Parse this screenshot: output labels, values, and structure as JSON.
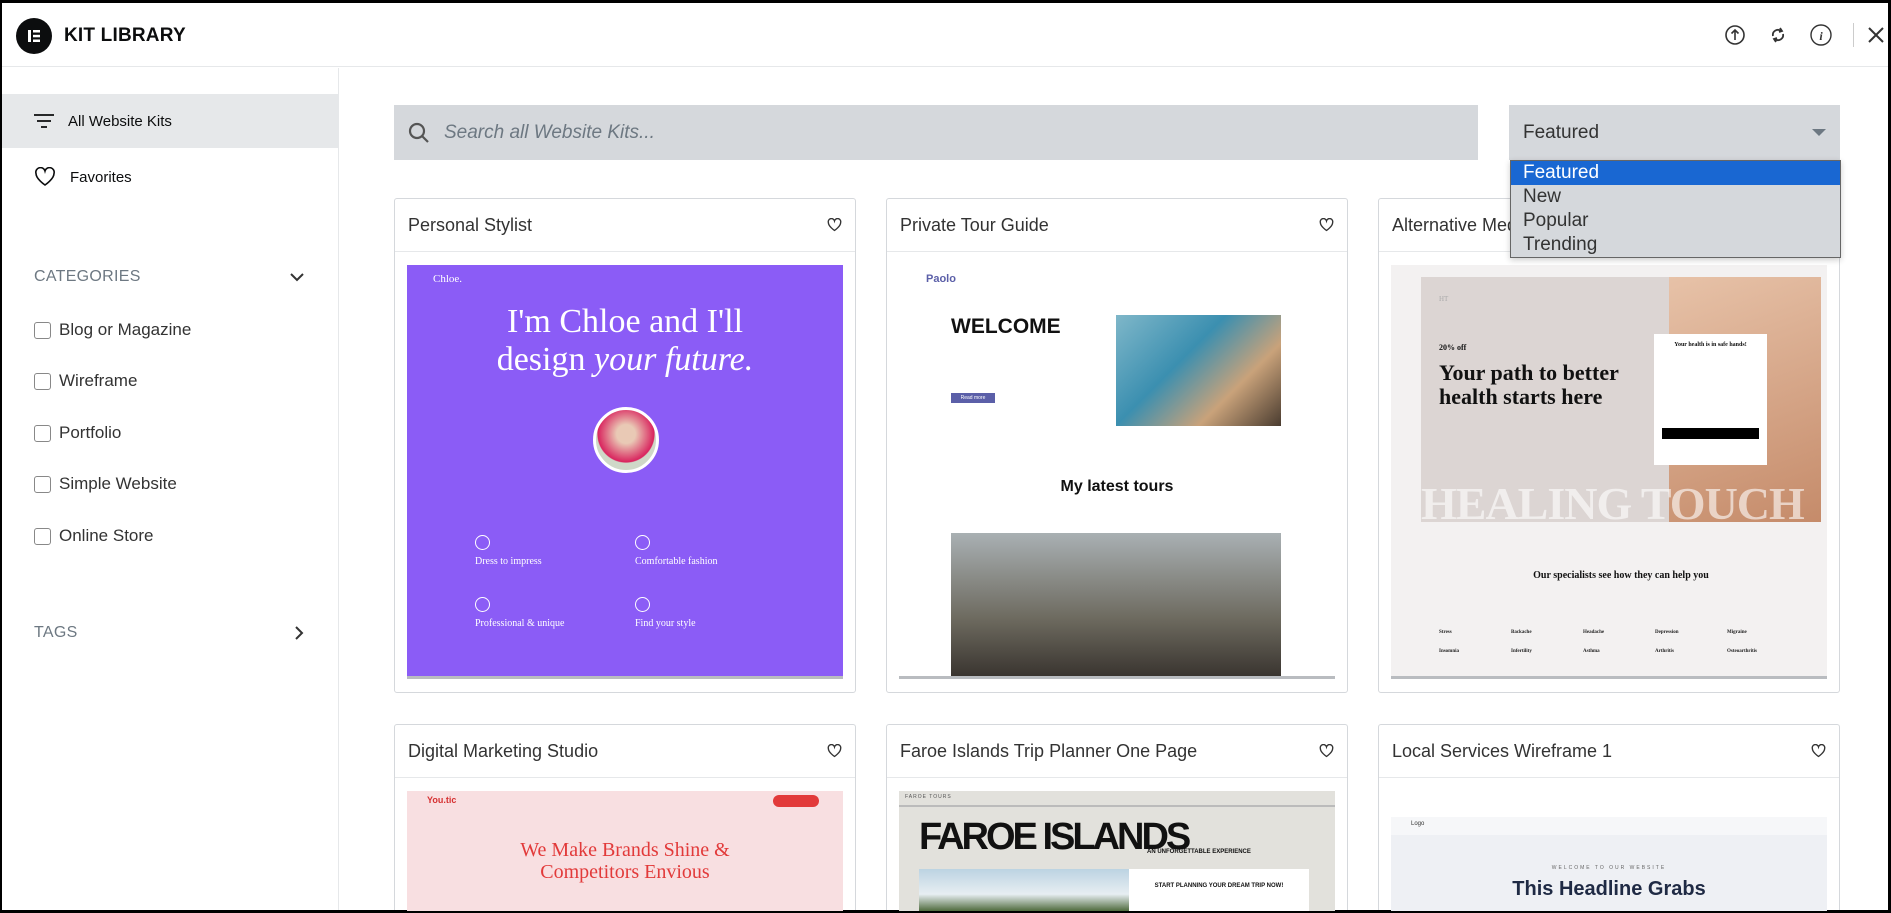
{
  "header": {
    "title": "KIT LIBRARY",
    "icons": [
      "elementor-logo-icon",
      "upload-icon",
      "sync-icon",
      "info-icon",
      "close-icon"
    ]
  },
  "sidebar": {
    "items": [
      {
        "label": "All Website Kits",
        "icon": "filter-lines-icon",
        "active": true
      },
      {
        "label": "Favorites",
        "icon": "heart-icon"
      }
    ],
    "categories_label": "CATEGORIES",
    "categories": [
      "Blog or Magazine",
      "Wireframe",
      "Portfolio",
      "Simple Website",
      "Online Store"
    ],
    "tags_label": "TAGS"
  },
  "search": {
    "placeholder": "Search all Website Kits...",
    "value": ""
  },
  "sort": {
    "selected": "Featured",
    "options": [
      "Featured",
      "New",
      "Popular",
      "Trending"
    ],
    "highlight_color": "#1967d2"
  },
  "kits": [
    {
      "title": "Personal Stylist",
      "preview": {
        "brand": "Chloe.",
        "headline1": "I'm Chloe and I'll",
        "headline2": "design ",
        "headline_em": "your future.",
        "features": [
          "Dress to impress",
          "Comfortable fashion",
          "Professional & unique",
          "Find your style"
        ],
        "bg": "#8b5cf6"
      }
    },
    {
      "title": "Private Tour Guide",
      "preview": {
        "brand": "Paolo",
        "headline": "WELCOME",
        "section": "My latest tours",
        "button": "Read more"
      }
    },
    {
      "title": "Alternative Med",
      "preview": {
        "brand": "HT",
        "promo": "20% off",
        "headline": "Your path to better health starts here",
        "form_title": "Your health is in safe hands!",
        "bg_text": "HEALING TOUCH",
        "section": "Our specialists see how they can help you",
        "conditions": [
          "Stress",
          "Backache",
          "Headache",
          "Depression",
          "Migraine",
          "Insomnia",
          "Infertility",
          "Asthma",
          "Arthritis",
          "Osteoarthritis"
        ]
      }
    },
    {
      "title": "Digital Marketing Studio",
      "preview": {
        "brand": "You.tic",
        "headline": "We Make Brands Shine & Competitors Envious"
      }
    },
    {
      "title": "Faroe Islands Trip Planner One Page",
      "preview": {
        "brand": "FAROE TOURS",
        "headline": "FAROE ISLANDS",
        "sub": "AN UNFORGETTABLE EXPERIENCE",
        "cta": "START PLANNING YOUR DREAM TRIP NOW!"
      }
    },
    {
      "title": "Local Services Wireframe 1",
      "preview": {
        "brand": "Logo",
        "eyebrow": "WELCOME TO OUR WEBSITE",
        "headline": "This Headline Grabs"
      }
    }
  ]
}
